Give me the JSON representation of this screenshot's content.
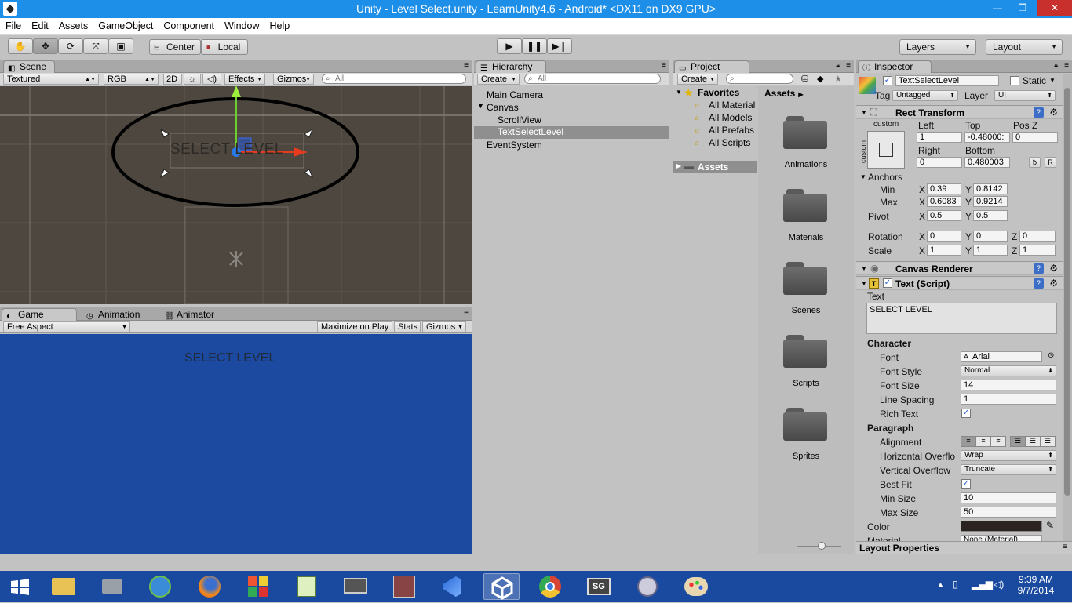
{
  "window": {
    "title": "Unity - Level Select.unity - LearnUnity4.6 - Android* <DX11 on DX9 GPU>"
  },
  "menu": [
    "File",
    "Edit",
    "Assets",
    "GameObject",
    "Component",
    "Window",
    "Help"
  ],
  "toolbar": {
    "pivot": "Center",
    "space": "Local",
    "layers": "Layers",
    "layout": "Layout"
  },
  "scene": {
    "tab": "Scene",
    "shading": "Textured",
    "render": "RGB",
    "mode2d": "2D",
    "effects": "Effects",
    "gizmos": "Gizmos",
    "search_placeholder": "All",
    "object_text": "SELECT LEVEL"
  },
  "game": {
    "tabs": [
      "Game",
      "Animation",
      "Animator"
    ],
    "aspect": "Free Aspect",
    "maximize": "Maximize on Play",
    "stats": "Stats",
    "gizmos": "Gizmos",
    "text": "SELECT LEVEL"
  },
  "hierarchy": {
    "tab": "Hierarchy",
    "create": "Create",
    "search_placeholder": "All",
    "items": [
      "Main Camera",
      "Canvas",
      "ScrollView",
      "TextSelectLevel",
      "EventSystem"
    ]
  },
  "project": {
    "tab": "Project",
    "create": "Create",
    "favorites": "Favorites",
    "fav_items": [
      "All Material",
      "All Models",
      "All Prefabs",
      "All Scripts"
    ],
    "assets_root": "Assets",
    "breadcrumb": "Assets",
    "folders": [
      "Animations",
      "Materials",
      "Scenes",
      "Scripts",
      "Sprites"
    ]
  },
  "inspector": {
    "tab": "Inspector",
    "name": "TextSelectLevel",
    "static": "Static",
    "tag_label": "Tag",
    "tag": "Untagged",
    "layer_label": "Layer",
    "layer": "UI",
    "rect": {
      "title": "Rect Transform",
      "preset": "custom",
      "preset_side": "custom",
      "left_label": "Left",
      "top_label": "Top",
      "posz_label": "Pos Z",
      "left": "1",
      "top": "-0.48000:",
      "posz": "0",
      "right_label": "Right",
      "bottom_label": "Bottom",
      "right": "0",
      "bottom": "0.480003",
      "r_btn": "R",
      "anchors": "Anchors",
      "min_label": "Min",
      "max_label": "Max",
      "pivot_label": "Pivot",
      "min_x": "0.39",
      "min_y": "0.8142",
      "max_x": "0.6083",
      "max_y": "0.9214",
      "pivot_x": "0.5",
      "pivot_y": "0.5",
      "rotation_label": "Rotation",
      "scale_label": "Scale",
      "rot_x": "0",
      "rot_y": "0",
      "rot_z": "0",
      "scale_x": "1",
      "scale_y": "1",
      "scale_z": "1",
      "x": "X",
      "y": "Y",
      "z": "Z"
    },
    "canvas_renderer": "Canvas Renderer",
    "text": {
      "title": "Text (Script)",
      "text_label": "Text",
      "text_value": "SELECT LEVEL",
      "character": "Character",
      "font_label": "Font",
      "font": "Arial",
      "font_style_label": "Font Style",
      "font_style": "Normal",
      "font_size_label": "Font Size",
      "font_size": "14",
      "line_spacing_label": "Line Spacing",
      "line_spacing": "1",
      "rich_text_label": "Rich Text",
      "paragraph": "Paragraph",
      "alignment_label": "Alignment",
      "hoverflow_label": "Horizontal Overflo",
      "hoverflow": "Wrap",
      "voverflow_label": "Vertical Overflow",
      "voverflow": "Truncate",
      "bestfit_label": "Best Fit",
      "minsize_label": "Min Size",
      "minsize": "10",
      "maxsize_label": "Max Size",
      "maxsize": "50",
      "color_label": "Color",
      "material_label": "Material",
      "material": "None (Material)"
    },
    "layout_properties": "Layout Properties"
  },
  "taskbar": {
    "time": "9:39 AM",
    "date": "9/7/2014"
  },
  "colors": {
    "title_blue": "#1e8fe8",
    "scene_bg": "#4d4740",
    "game_bg": "#1c4aa0",
    "taskbar": "#1a4aa0"
  }
}
